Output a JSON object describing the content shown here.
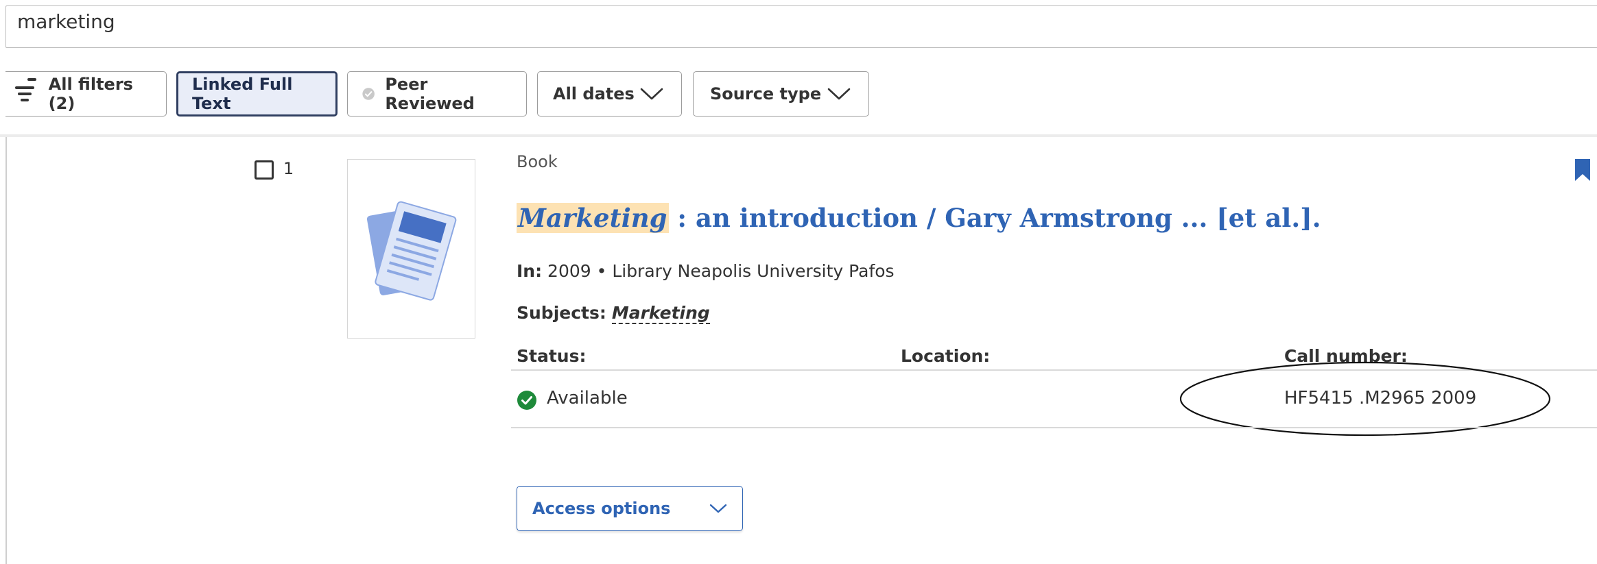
{
  "search": {
    "query": "marketing"
  },
  "filters": {
    "all_filters": "All filters (2)",
    "linked_full_text": "Linked Full Text",
    "peer_reviewed": "Peer Reviewed",
    "all_dates": "All dates",
    "source_type": "Source type"
  },
  "result": {
    "number": "1",
    "type": "Book",
    "title_highlight": "Marketing",
    "title_rest": " : an introduction / Gary Armstrong ... [et al.].",
    "in_label": "In:",
    "in_value": " 2009 • Library Neapolis University Pafos",
    "subjects_label": "Subjects:",
    "subject": "Marketing",
    "status_label": "Status:",
    "location_label": "Location:",
    "callno_label": "Call number:",
    "status_value": "Available",
    "callno_value": "HF5415 .M2965 2009",
    "access_options": "Access options"
  },
  "colors": {
    "link_blue": "#2f64b4",
    "highlight": "#fde2b3",
    "available_green": "#1e8a3a",
    "active_chip_bg": "#e9edf8"
  },
  "icons": [
    "filter-icon",
    "peer-reviewed-icon",
    "chevron-down-icon",
    "document-thumbnail-icon",
    "bookmark-icon",
    "check-circle-icon"
  ]
}
